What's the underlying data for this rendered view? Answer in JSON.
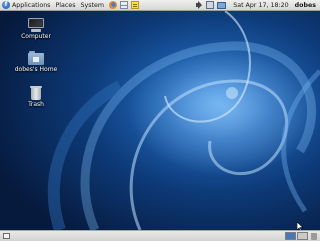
{
  "top_panel": {
    "menus": [
      "Applications",
      "Places",
      "System"
    ],
    "launchers": [
      "firefox-icon",
      "mail-icon",
      "notes-icon"
    ],
    "tray_icons": [
      "speaker-icon",
      "network-icon",
      "battery-icon"
    ],
    "clock": "Sat Apr 17, 18:20",
    "user": "dobes"
  },
  "desktop": {
    "icons": [
      {
        "label": "Computer",
        "icon": "computer-icon"
      },
      {
        "label": "dobes's Home",
        "icon": "home-folder-icon"
      },
      {
        "label": "Trash",
        "icon": "trash-icon"
      }
    ]
  },
  "bottom_panel": {
    "workspaces": 2,
    "active_workspace": 1
  },
  "colors": {
    "wallpaper_base": "#0a2a57",
    "wallpaper_glow": "#3a86d6",
    "panel": "#e4e4e2",
    "workspace_active": "#4a77b8"
  }
}
